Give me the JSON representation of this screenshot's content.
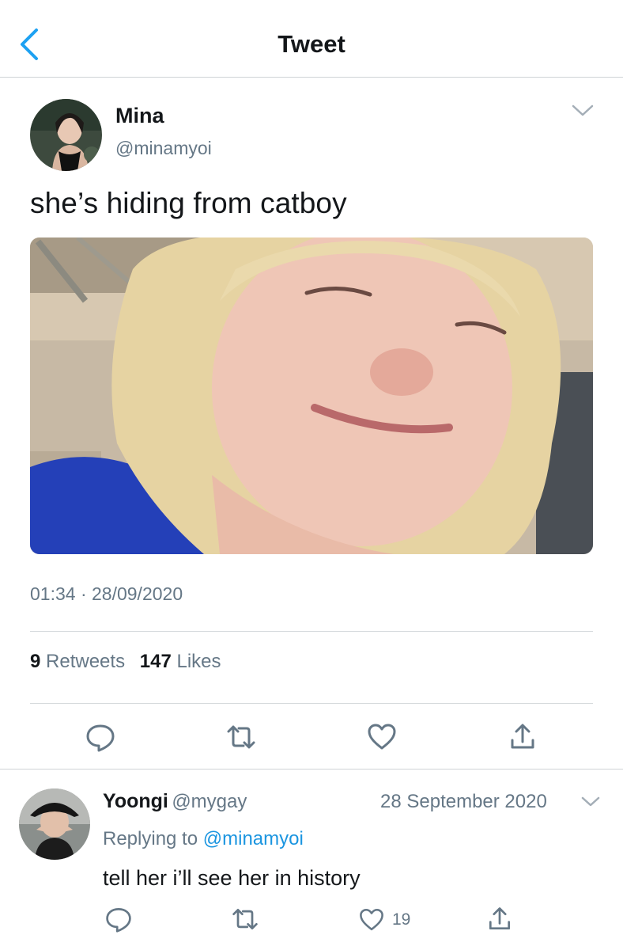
{
  "header": {
    "title": "Tweet"
  },
  "tweet": {
    "author_name": "Mina",
    "author_handle": "@minamyoi",
    "text": "she’s hiding from catboy",
    "timestamp": "01:34 · 28/09/2020",
    "retweets_count": "9",
    "retweets_label": "Retweets",
    "likes_count": "147",
    "likes_label": "Likes"
  },
  "reply": {
    "author_name": "Yoongi",
    "author_handle": "@mygay",
    "date": "28 September 2020",
    "replying_prefix": "Replying to",
    "replying_to": "@minamyoi",
    "text": "tell her i’ll see her in history",
    "likes_count": "19"
  },
  "icons": [
    "back-chevron-icon",
    "chevron-down-icon",
    "reply-icon",
    "retweet-icon",
    "like-icon",
    "share-icon"
  ],
  "colors": {
    "link": "#1b95e0",
    "secondary_text": "#657786",
    "back_arrow": "#1da1f2"
  }
}
